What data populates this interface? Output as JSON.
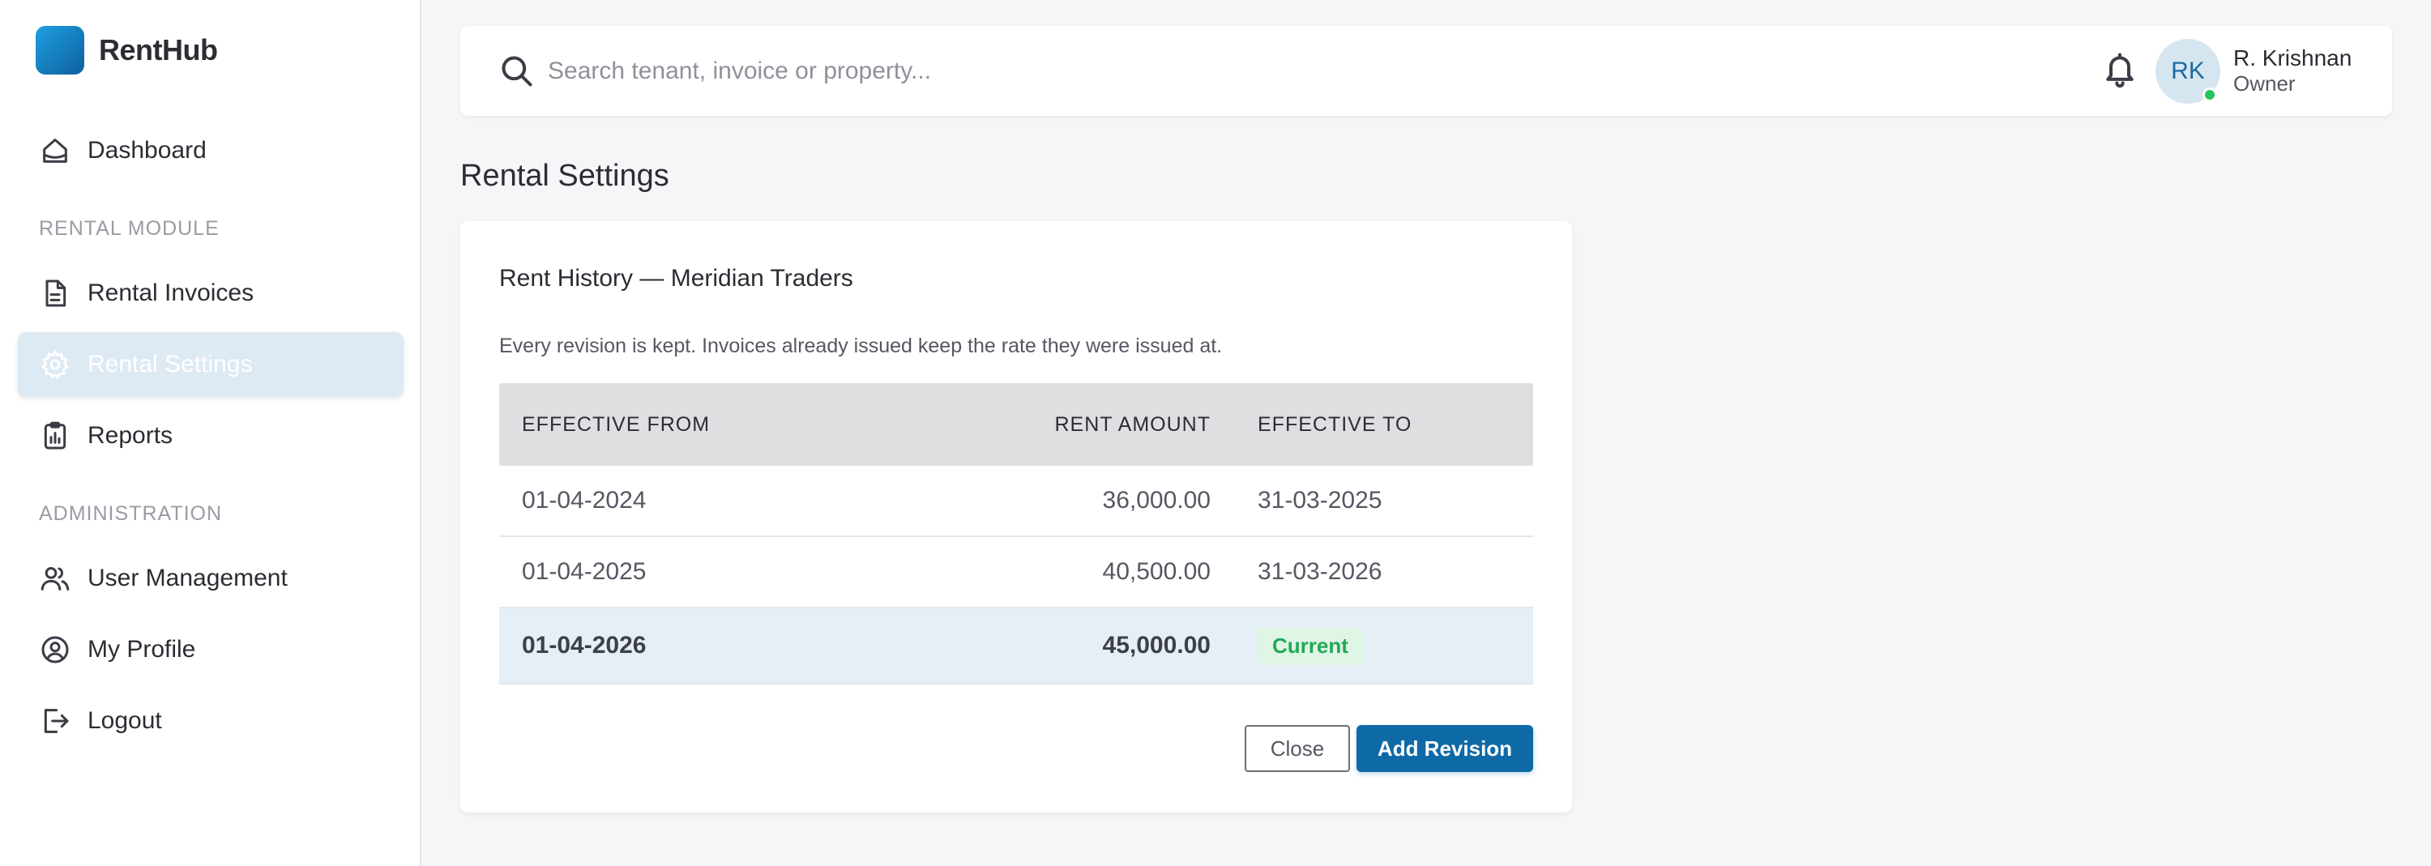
{
  "brand": {
    "name": "RentHub"
  },
  "sidebar": {
    "dashboard": {
      "label": "Dashboard",
      "icon": "home-icon"
    },
    "sections": [
      {
        "label": "RENTAL MODULE"
      },
      {
        "label": "ADMINISTRATION"
      }
    ],
    "items": [
      {
        "label": "Rental Invoices",
        "icon": "invoice-icon",
        "active": false
      },
      {
        "label": "Rental Settings",
        "icon": "gear-icon",
        "active": true
      },
      {
        "label": "Reports",
        "icon": "clipboard-chart-icon",
        "active": false
      },
      {
        "label": "User Management",
        "icon": "users-icon",
        "active": false
      },
      {
        "label": "My Profile",
        "icon": "user-circle-icon",
        "active": false
      },
      {
        "label": "Logout",
        "icon": "logout-icon",
        "active": false
      }
    ]
  },
  "header": {
    "search": {
      "placeholder": "Search tenant, invoice or property...",
      "value": ""
    },
    "user": {
      "initials": "RK",
      "name": "R. Krishnan",
      "role": "Owner",
      "online": true
    }
  },
  "main": {
    "page_title": "Rental Settings",
    "card": {
      "title": "Rent History — Meridian Traders",
      "description": "Every revision is kept. Invoices already issued keep the rate they were issued at.",
      "columns": [
        "EFFECTIVE FROM",
        "RENT AMOUNT",
        "EFFECTIVE TO"
      ],
      "rows": [
        {
          "effective_from": "01-04-2024",
          "rent_amount": "36,000.00",
          "effective_to": "31-03-2025"
        },
        {
          "effective_from": "01-04-2025",
          "rent_amount": "40,500.00",
          "effective_to": "31-03-2026"
        },
        {
          "effective_from": "01-04-2026",
          "rent_amount": "45,000.00",
          "effective_to": "Current"
        }
      ],
      "buttons": {
        "close": "Close",
        "add": "Add Revision"
      }
    }
  },
  "colors": {
    "accent": "#0e6aa6",
    "active_nav_bg": "#dde9f3",
    "current_badge_bg": "#dff5e5",
    "current_badge_text": "#22a957",
    "presence": "#22c55e"
  }
}
